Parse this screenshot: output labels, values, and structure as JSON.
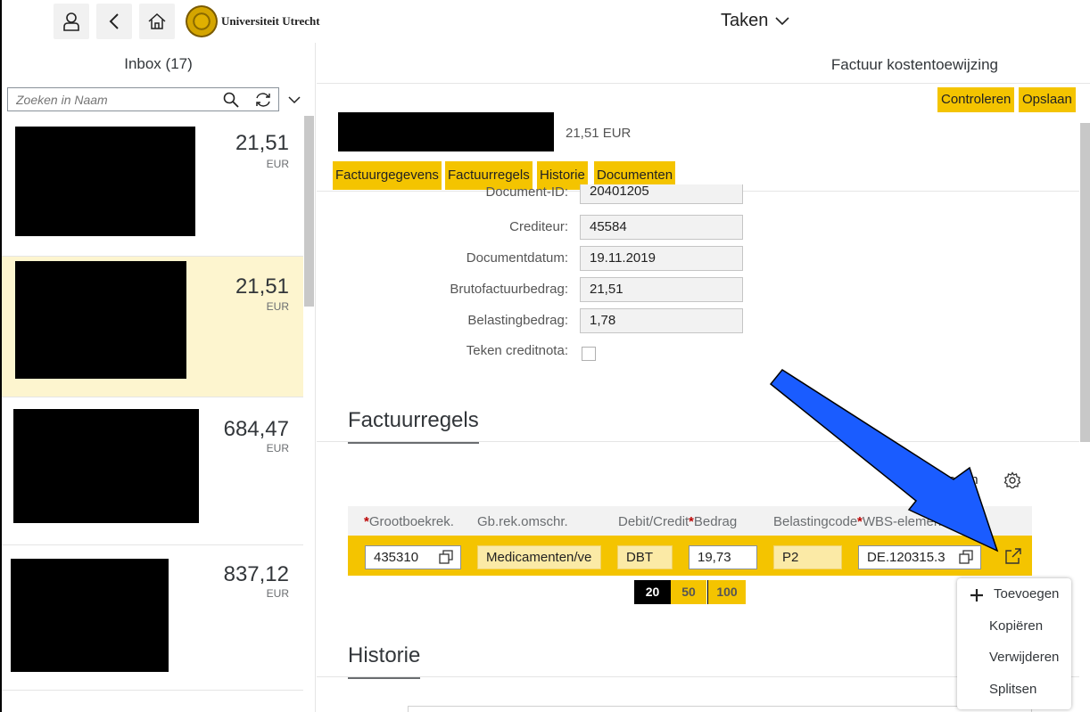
{
  "shell": {
    "logo_text": "Universiteit Utrecht",
    "title": "Taken",
    "icons": [
      "user-icon",
      "back-icon",
      "home-icon",
      "chevron-down-icon"
    ]
  },
  "master": {
    "title": "Inbox (17)",
    "search_placeholder": "Zoeken in Naam",
    "items": [
      {
        "amount": "21,51",
        "currency": "EUR"
      },
      {
        "amount": "21,51",
        "currency": "EUR"
      },
      {
        "amount": "684,47",
        "currency": "EUR"
      },
      {
        "amount": "837,12",
        "currency": "EUR"
      }
    ]
  },
  "detail": {
    "title": "Factuur kostentoewijzing",
    "buttons": {
      "check": "Controleren",
      "save": "Opslaan"
    },
    "header_amount": "21,51 EUR",
    "tabs": [
      "Factuurgegevens",
      "Factuurregels",
      "Historie",
      "Documenten"
    ],
    "form": [
      {
        "label": "Document-ID:",
        "value": "20401205"
      },
      {
        "label": "Crediteur:",
        "value": "45584"
      },
      {
        "label": "Documentdatum:",
        "value": "19.11.2019"
      },
      {
        "label": "Brutofactuurbedrag:",
        "value": "21,51"
      },
      {
        "label": "Belastingbedrag:",
        "value": "1,78"
      }
    ],
    "credit_note_label": "Teken creditnota:",
    "sections": {
      "lines": "Factuurregels",
      "history": "Historie"
    },
    "table": {
      "add_label": "evoegen",
      "columns": [
        "Grootboekrek.",
        "Gb.rek.omschr.",
        "Debit/Credit",
        "Bedrag",
        "Belastingcode",
        "WBS-element"
      ],
      "row": {
        "gl_account": "435310",
        "gl_description": "Medicamenten/ve",
        "debit_credit": "DBT",
        "amount": "19,73",
        "tax_code": "P2",
        "wbs": "DE.120315.3"
      }
    },
    "pager": [
      "20",
      "50",
      "100"
    ],
    "menu": [
      "Toevoegen",
      "Kopiëren",
      "Verwijderen",
      "Splitsen"
    ]
  },
  "colors": {
    "accent": "#f4c400",
    "selected": "#fdf5cf",
    "arrow": "#1a5cff"
  }
}
